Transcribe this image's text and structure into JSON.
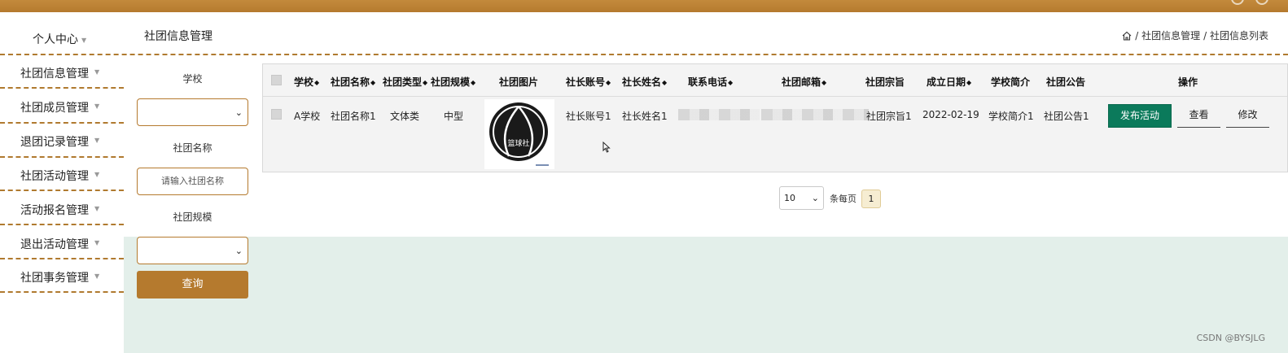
{
  "sidebar": {
    "personal_center": "个人中心",
    "items": [
      {
        "label": "社团信息管理"
      },
      {
        "label": "社团成员管理"
      },
      {
        "label": "退团记录管理"
      },
      {
        "label": "社团活动管理"
      },
      {
        "label": "活动报名管理"
      },
      {
        "label": "退出活动管理"
      },
      {
        "label": "社团事务管理"
      }
    ]
  },
  "header": {
    "page_title": "社团信息管理",
    "breadcrumb": [
      "/ 社团信息管理",
      "/ 社团信息列表"
    ]
  },
  "filters": {
    "school_label": "学校",
    "school_value": "",
    "club_name_label": "社团名称",
    "club_name_placeholder": "请输入社团名称",
    "club_scale_label": "社团规模",
    "club_scale_value": "",
    "query_button": "查询"
  },
  "table": {
    "columns": [
      "学校",
      "社团名称",
      "社团类型",
      "社团规模",
      "社团图片",
      "社长账号",
      "社长姓名",
      "联系电话",
      "社团邮箱",
      "社团宗旨",
      "成立日期",
      "学校简介",
      "社团公告",
      "操作"
    ],
    "rows": [
      {
        "school": "A学校",
        "club_name": "社团名称1",
        "club_type": "文体类",
        "club_scale": "中型",
        "club_image_text": "篮球社",
        "president_account": "社长账号1",
        "president_name": "社长姓名1",
        "phone": "",
        "email": "",
        "purpose": "社团宗旨1",
        "founded": "2022-02-19",
        "school_intro": "学校简介1",
        "announcement": "社团公告1",
        "actions": {
          "publish": "发布活动",
          "view": "查看",
          "edit": "修改"
        }
      }
    ]
  },
  "pagination": {
    "page_size": "10",
    "per_page_label": "条每页",
    "current_page": "1"
  },
  "colors": {
    "brand": "#b57a2e",
    "publish_button": "#0b7a5b",
    "pale_background": "#e3efea"
  },
  "watermark": "CSDN @BYSJLG"
}
